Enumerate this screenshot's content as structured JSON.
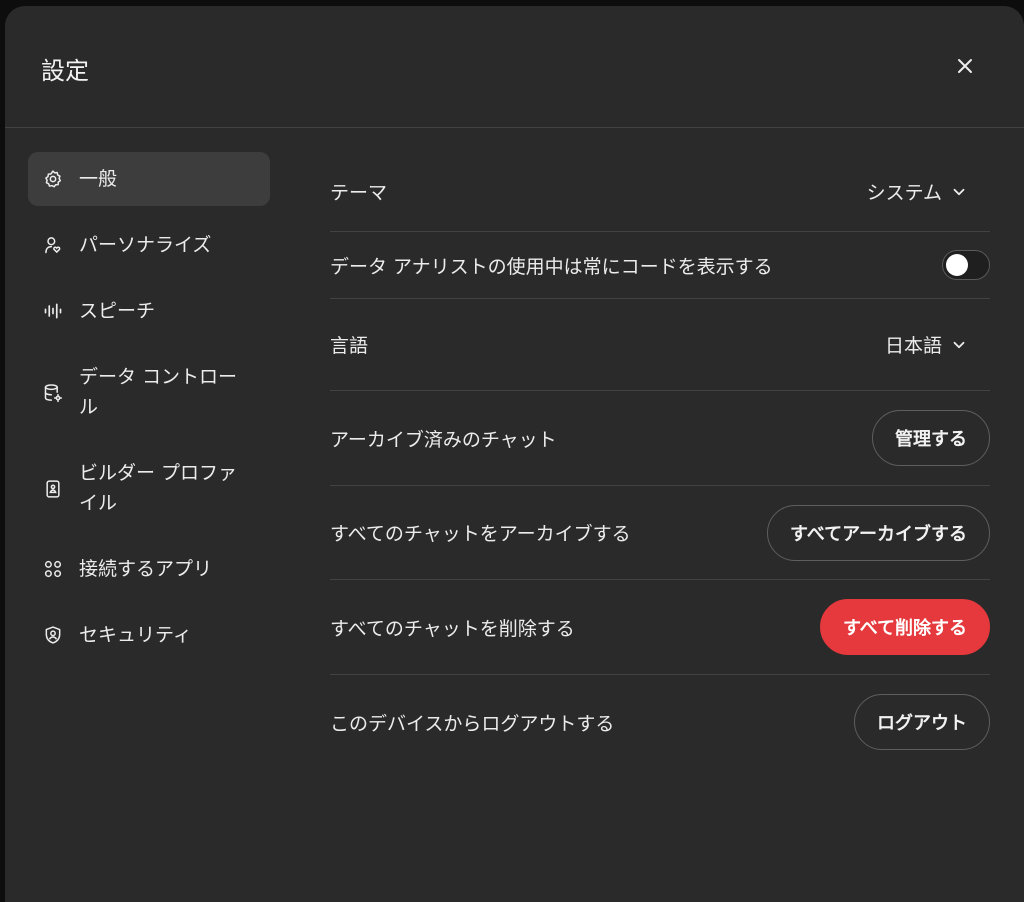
{
  "modal": {
    "title": "設定"
  },
  "sidebar": {
    "items": [
      {
        "label": "一般",
        "icon": "gear-icon",
        "active": true
      },
      {
        "label": "パーソナライズ",
        "icon": "user-heart-icon"
      },
      {
        "label": "スピーチ",
        "icon": "waveform-icon"
      },
      {
        "label": "データ コントロール",
        "icon": "database-gear-icon"
      },
      {
        "label": "ビルダー プロファイル",
        "icon": "id-badge-icon"
      },
      {
        "label": "接続するアプリ",
        "icon": "apps-grid-icon"
      },
      {
        "label": "セキュリティ",
        "icon": "shield-user-icon"
      }
    ]
  },
  "settings": {
    "theme": {
      "label": "テーマ",
      "value": "システム"
    },
    "code_toggle": {
      "label": "データ アナリストの使用中は常にコードを表示する",
      "enabled": false
    },
    "language": {
      "label": "言語",
      "value": "日本語"
    },
    "archived": {
      "label": "アーカイブ済みのチャット",
      "button": "管理する"
    },
    "archive_all": {
      "label": "すべてのチャットをアーカイブする",
      "button": "すべてアーカイブする"
    },
    "delete_all": {
      "label": "すべてのチャットを削除する",
      "button": "すべて削除する"
    },
    "logout": {
      "label": "このデバイスからログアウトする",
      "button": "ログアウト"
    }
  },
  "colors": {
    "danger": "#e5393d",
    "background": "#2a2a2a",
    "active_nav": "#3d3d3d"
  }
}
